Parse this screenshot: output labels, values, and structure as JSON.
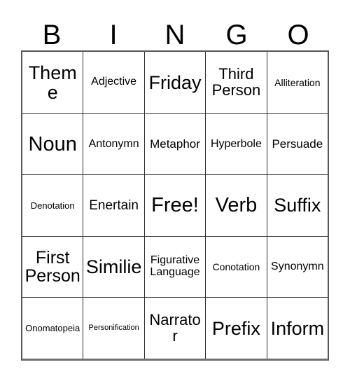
{
  "card": {
    "header_letters": [
      "B",
      "I",
      "N",
      "G",
      "O"
    ],
    "border_color": "#2b2d2f",
    "outer_border_color": "#555759",
    "text_color": "#000000",
    "background_color": "#ffffff",
    "columns": 5,
    "rows": 5,
    "free_space_label": "Free!",
    "free_space_position": "N3"
  },
  "grid": {
    "rows": [
      {
        "cells": [
          {
            "label": "Theme",
            "size": "fs-3xl"
          },
          {
            "label": "Adjective",
            "size": "fs-md"
          },
          {
            "label": "Friday",
            "size": "fs-3xl"
          },
          {
            "label": "Third Person",
            "size": "fs-xl"
          },
          {
            "label": "Alliteration",
            "size": "fs-smd"
          }
        ]
      },
      {
        "cells": [
          {
            "label": "Noun",
            "size": "fs-4xl"
          },
          {
            "label": "Antonymn",
            "size": "fs-md"
          },
          {
            "label": "Metaphor",
            "size": "fs-mdl"
          },
          {
            "label": "Hyperbole",
            "size": "fs-md"
          },
          {
            "label": "Persuade",
            "size": "fs-mdl"
          }
        ]
      },
      {
        "cells": [
          {
            "label": "Denotation",
            "size": "fs-sm"
          },
          {
            "label": "Enertain",
            "size": "fs-lg"
          },
          {
            "label": "Free!",
            "size": "fs-4xl"
          },
          {
            "label": "Verb",
            "size": "fs-4xl"
          },
          {
            "label": "Suffix",
            "size": "fs-3xl"
          }
        ]
      },
      {
        "cells": [
          {
            "label": "First Person",
            "size": "fs-2xl"
          },
          {
            "label": "Similie",
            "size": "fs-3xl"
          },
          {
            "label": "Figurative Language",
            "size": "fs-md"
          },
          {
            "label": "Conotation",
            "size": "fs-smd"
          },
          {
            "label": "Synonymn",
            "size": "fs-md"
          }
        ]
      },
      {
        "cells": [
          {
            "label": "Onomatopeia",
            "size": "fs-sm"
          },
          {
            "label": "Personification",
            "size": "fs-xs"
          },
          {
            "label": "Narrator",
            "size": "fs-xl"
          },
          {
            "label": "Prefix",
            "size": "fs-3xl"
          },
          {
            "label": "Inform",
            "size": "fs-3xl"
          }
        ]
      }
    ]
  }
}
